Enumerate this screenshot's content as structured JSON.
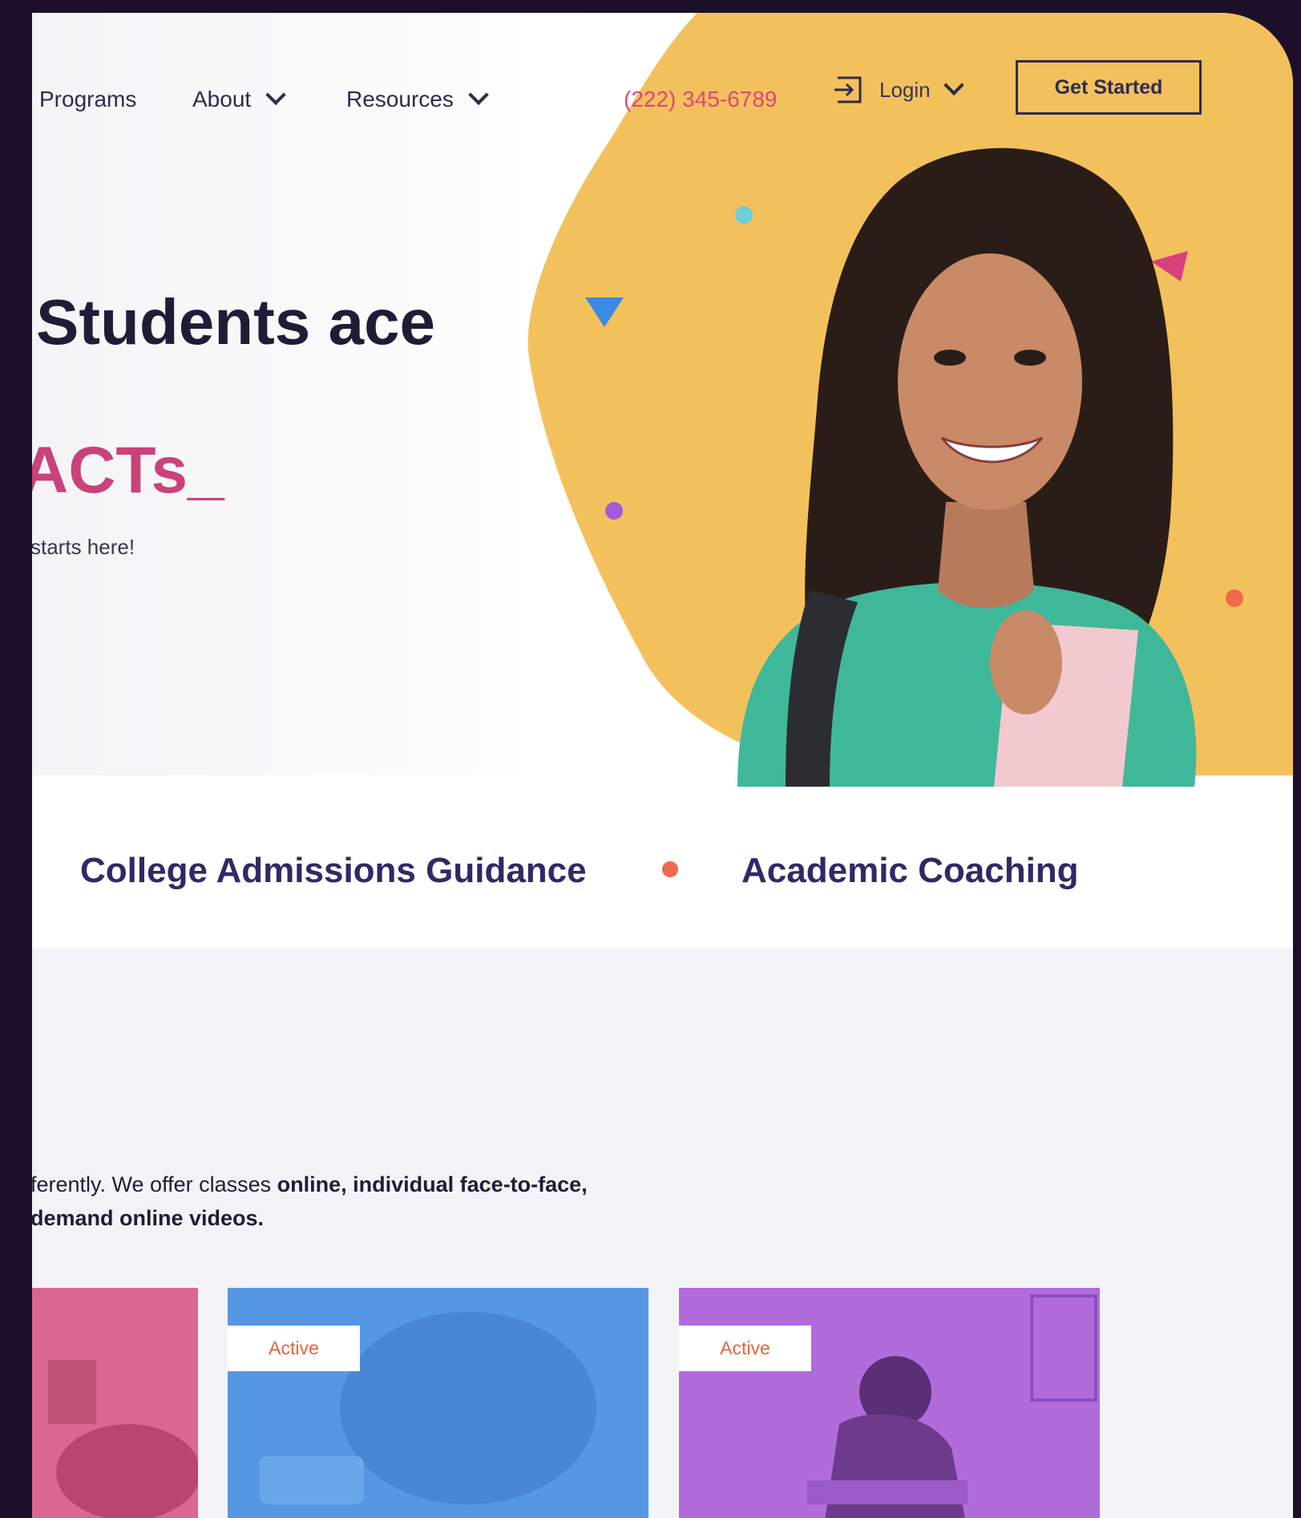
{
  "nav": {
    "programs": "Programs",
    "about": "About",
    "resources": "Resources",
    "phone": "(222) 345-6789",
    "login": "Login",
    "cta": "Get Started"
  },
  "hero": {
    "headline": "Students ace",
    "rotator": "ACTs_",
    "subtitle": "starts here!"
  },
  "services": [
    "College Admissions Guidance",
    "Academic Coaching"
  ],
  "intro": {
    "line1_plain": "ferently. We offer classes ",
    "line1_bold": "online, individual face-to-face,",
    "line2_bold": "demand online videos."
  },
  "cards": [
    {
      "badge": "",
      "color": "#d9678f"
    },
    {
      "badge": "Active",
      "color": "#5597e3"
    },
    {
      "badge": "Active",
      "color": "#b26bdb"
    }
  ],
  "colors": {
    "accent_yellow": "#f3c15c",
    "accent_pink": "#e0457b",
    "navy": "#2e2a66"
  }
}
